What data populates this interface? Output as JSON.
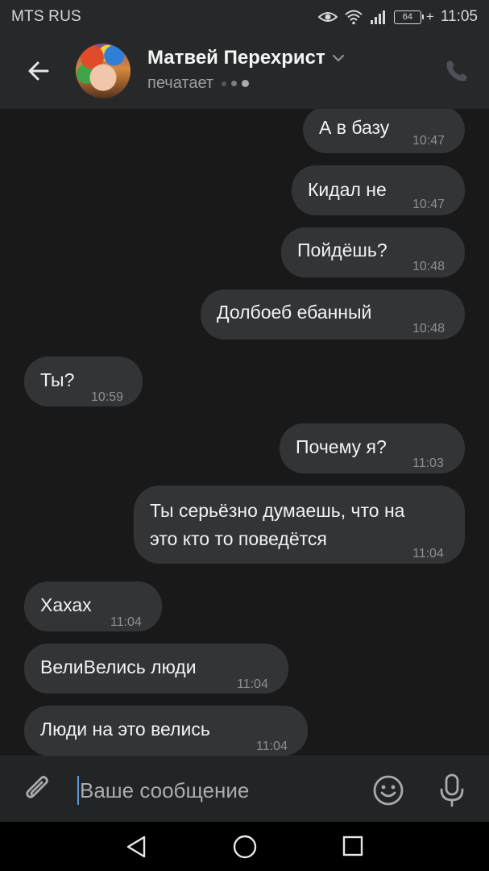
{
  "status_bar": {
    "carrier": "MTS RUS",
    "battery": "64",
    "time": "11:05"
  },
  "header": {
    "contact_name": "Матвей Перехрист",
    "status": "печатает"
  },
  "messages": [
    {
      "text": "А в базу",
      "time": "10:47",
      "direction": "outgoing"
    },
    {
      "text": "Кидал не",
      "time": "10:47",
      "direction": "outgoing"
    },
    {
      "text": "Пойдёшь?",
      "time": "10:48",
      "direction": "outgoing"
    },
    {
      "text": "Долбоеб ебанный",
      "time": "10:48",
      "direction": "outgoing"
    },
    {
      "text": "Ты?",
      "time": "10:59",
      "direction": "incoming"
    },
    {
      "text": "Почему я?",
      "time": "11:03",
      "direction": "outgoing"
    },
    {
      "text_line1": "Ты серьёзно думаешь, что на",
      "text_line2": "это кто то поведётся",
      "time": "11:04",
      "direction": "outgoing"
    },
    {
      "text": "Хахах",
      "time": "11:04",
      "direction": "incoming"
    },
    {
      "text": "ВелиВелись люди",
      "time": "11:04",
      "direction": "incoming"
    },
    {
      "text": "Люди на это велись",
      "time": "11:04",
      "direction": "incoming"
    }
  ],
  "composer": {
    "placeholder": "Ваше сообщение"
  },
  "icons": {
    "back": "arrow-left-icon",
    "dropdown": "chevron-down-icon",
    "phone": "phone-icon",
    "attach": "paperclip-icon",
    "emoji": "smiley-icon",
    "mic": "microphone-icon",
    "eye": "eye-icon",
    "wifi": "wifi-icon",
    "signal": "signal-icon",
    "nav_back": "triangle-back-icon",
    "nav_home": "circle-home-icon",
    "nav_recent": "square-recents-icon"
  },
  "colors": {
    "background": "#19191a",
    "header": "#272829",
    "bubble": "#333436",
    "timestamp": "#8b8f94",
    "caret": "#5a9bd8"
  }
}
